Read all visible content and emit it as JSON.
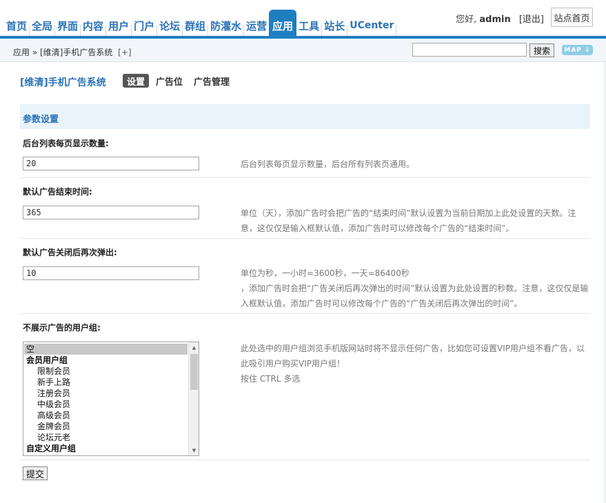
{
  "nav": {
    "items": [
      "首页",
      "全局",
      "界面",
      "内容",
      "用户",
      "门户",
      "论坛",
      "群组",
      "防灌水",
      "运营",
      "应用",
      "工具",
      "站长",
      "UCenter"
    ],
    "active_index": 10
  },
  "user": {
    "greeting": "您好,",
    "name": "admin",
    "logout": "[退出]",
    "home_button": "站点首页"
  },
  "breadcrumb": {
    "text": "应用 » [维清]手机广告系统",
    "plus": "[+]"
  },
  "search": {
    "value": "",
    "button": "搜索"
  },
  "map_button": "MAP ⇩",
  "page": {
    "title": "[维清]手机广告系统",
    "tabs": [
      "设置",
      "广告位",
      "广告管理"
    ],
    "active_tab": 0
  },
  "section": {
    "title": "参数设置"
  },
  "settings": [
    {
      "label": "后台列表每页显示数量:",
      "value": "20",
      "tip": "后台列表每页显示数量，后台所有列表页通用。"
    },
    {
      "label": "默认广告结束时间:",
      "value": "365",
      "tip": "单位（天），添加广告时会把广告的“结束时间”默认设置为当前日期加上此处设置的天数。注意，这仅仅是输入框默认值，添加广告时可以修改每个广告的“结束时间”。"
    },
    {
      "label": "默认广告关闭后再次弹出:",
      "value": "10",
      "tip_line1": "单位为秒，一小时=3600秒，一天=86400秒",
      "tip_rest": "，添加广告时会把“广告关闭后再次弹出的时间”默认设置为此处设置的秒数。注意，这仅仅是输入框默认值，添加广告时可以修改每个广告的“广告关闭后再次弹出的时间”。"
    }
  ],
  "usergroups": {
    "label": "不展示广告的用户组:",
    "options": [
      {
        "text": "空",
        "type": "option",
        "selected": true
      },
      {
        "text": "会员用户组",
        "type": "group"
      },
      {
        "text": "限制会员",
        "type": "child"
      },
      {
        "text": "新手上路",
        "type": "child"
      },
      {
        "text": "注册会员",
        "type": "child"
      },
      {
        "text": "中级会员",
        "type": "child"
      },
      {
        "text": "高级会员",
        "type": "child"
      },
      {
        "text": "金牌会员",
        "type": "child"
      },
      {
        "text": "论坛元老",
        "type": "child"
      },
      {
        "text": "自定义用户组",
        "type": "group"
      }
    ],
    "tip": "此处选中的用户组浏览手机版网站时将不显示任何广告，比如您可设置VIP用户组不看广告，以此吸引用户购买VIP用户组！",
    "tip2": "按住 CTRL 多选"
  },
  "submit_label": "提交"
}
